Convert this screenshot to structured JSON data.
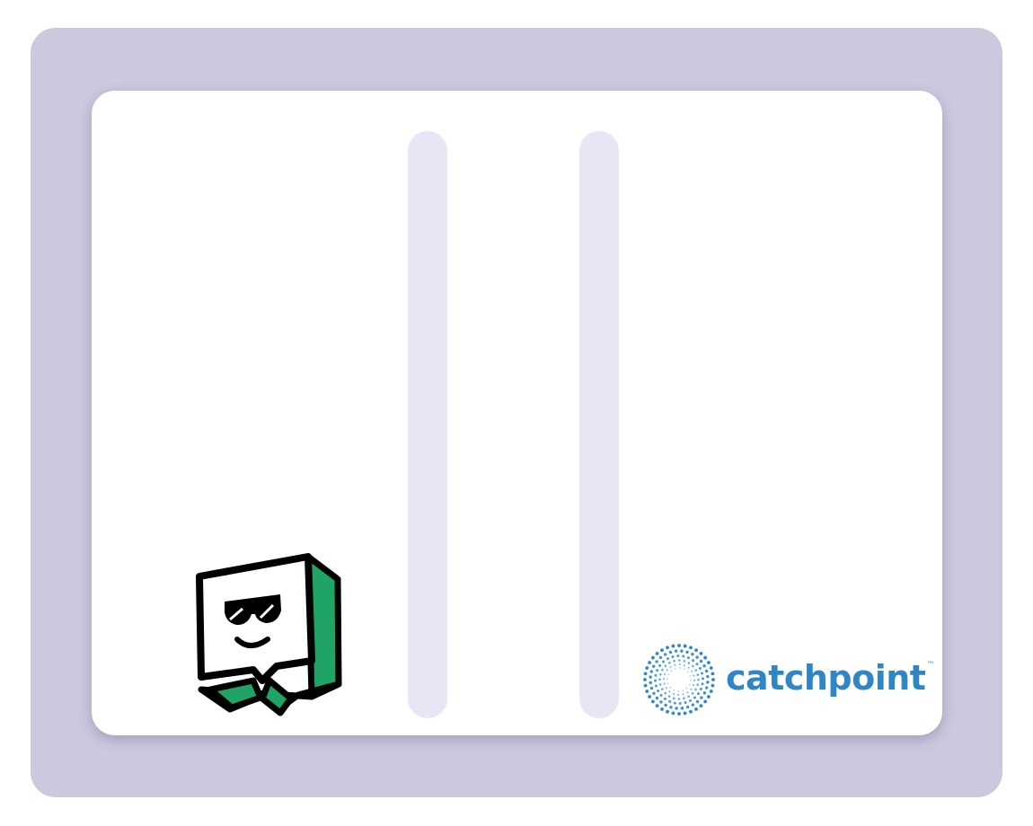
{
  "colors": {
    "frame": "#cac9de",
    "card": "#ffffff",
    "divider": "#e8e6f4",
    "mascot_green": "#1fa466",
    "catchpoint_blue": "#2f86c6"
  },
  "left_logo": {
    "icon": "sunglasses-speech-bubble-mascot-icon"
  },
  "right_logo": {
    "icon": "catchpoint-burst-icon",
    "wordmark": "catchpoint",
    "trademark": "™"
  }
}
